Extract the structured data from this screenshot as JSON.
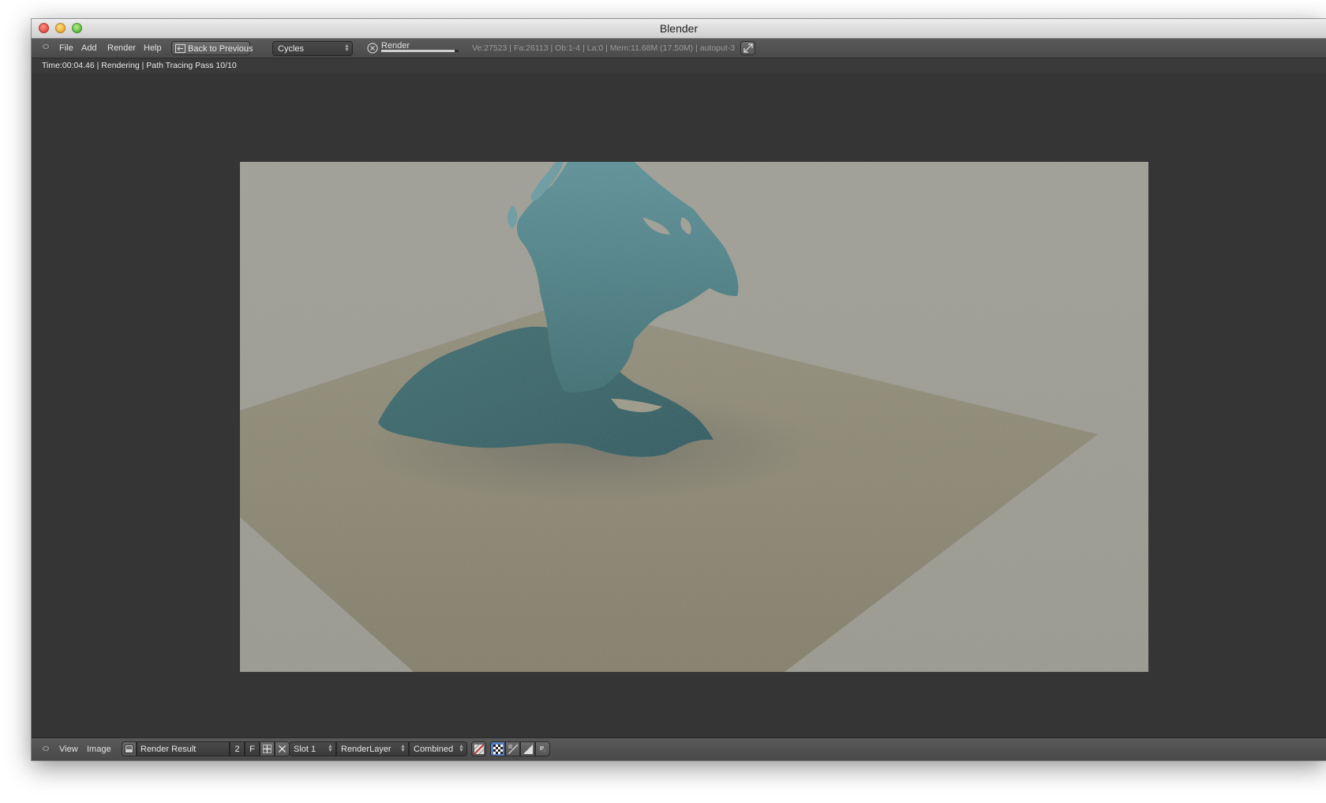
{
  "window": {
    "title": "Blender"
  },
  "header": {
    "menus": [
      "File",
      "Add",
      "Render",
      "Help"
    ],
    "back_button": "Back to Previous",
    "engine": "Cycles",
    "render_progress_label": "Render",
    "render_progress": 0.95,
    "stats": "Ve:27523 | Fa:26113 | Ob:1-4 | La:0 | Mem:11.68M (17.50M) | autoput-3"
  },
  "info": {
    "status": "Time:00:04.46 | Rendering | Path Tracing Pass 10/10"
  },
  "footer": {
    "menus": [
      "View",
      "Image"
    ],
    "image_name": "Render Result",
    "users": "2",
    "fake_user": "F",
    "slot": "Slot 1",
    "layer": "RenderLayer",
    "pass": "Combined"
  },
  "colors": {
    "background": "#9c9b91",
    "floor": "#8a8672",
    "fluid": "#4f868e"
  },
  "icons": [
    "close-icon",
    "minimize-icon",
    "maximize-icon",
    "editor-type-icon",
    "cancel-icon",
    "fullscreen-icon",
    "image-icon",
    "new-image-icon",
    "unlink-icon",
    "alpha-icon",
    "checker-icon",
    "channel-icon",
    "z-buffer-icon",
    "draw-mode-icon"
  ]
}
